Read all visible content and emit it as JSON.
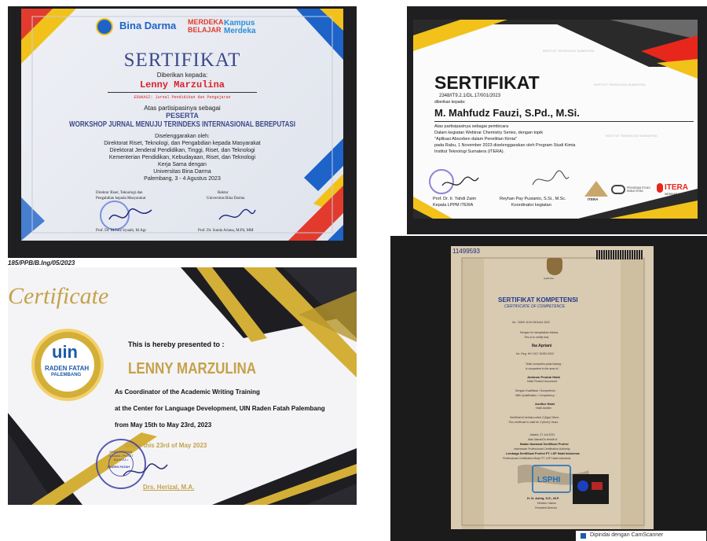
{
  "cert1": {
    "logo_bina": "Bina Darma",
    "logo_merdeka": "MERDEKA BELAJAR",
    "logo_kampus": "Kampus Merdeka",
    "title": "SERTIFIKAT",
    "given_to": "Diberikan kepada:",
    "name": "Lenny Marzulina",
    "edukasi": "EDUKASI: Jurnal Pendidikan dan Pengajaran",
    "atas": "Atas partisipasinya sebagai",
    "role": "PESERTA",
    "event": "WORKSHOP JURNAL MENUJU TERINDEKS INTERNASIONAL BEREPUTASI",
    "organized": "Diselenggarakan oleh:",
    "org1": "Direktorat Riset, Teknologi, dan Pengabdian kepada Masyarakat",
    "org2": "Direktorat Jenderal Pendidikan, Tinggi, Riset, dan Teknologi",
    "org3": "Kementerian Pendidikan, Kebudayaan, Riset, dan Teknologi",
    "coop": "Kerja Sama dengan",
    "univ": "Universitas Bina Darma",
    "place_date": "Palembang, 3 - 4 Agustus 2023",
    "sig_left_title1": "Direktur Riset, Teknologi dan",
    "sig_left_title2": "Pengabdian kepada Masyarakat",
    "sig_left_name": "Prof. Dr. M.Faiz Syuaib, M.Agr",
    "sig_right_title1": "Rektor",
    "sig_right_title2": "Universitas Bina Darma",
    "sig_right_name": "Prof. Dr. Sunda Ariana, M.Pd, MM"
  },
  "cert2": {
    "watermark": "INSTITUT TEKNOLOGI SUMATERA",
    "title": "SERTIFIKAT",
    "number": "2348/IT9.2.1/DL.17/001/2023",
    "given_to": "diberikan kepada:",
    "name": "M. Mahfudz Fauzi, S.Pd., M.Si.",
    "line1": "Atas partisipasinya sebagai pembicara",
    "line2": "Dalam kegiatan Webinar Chemistry Series, dengan topik",
    "line3": "\"Aplikasi Absorben dalam Penelitian Kimia\"",
    "line4": "pada Rabu, 1 November 2023 diselenggarakan oleh Program Studi Kimia",
    "line5": "Institut Teknologi Sumatera (ITERA).",
    "sig_left_name": "Prof. Dr. Ir. Yahdi Zaim",
    "sig_left_role": "Kepala LPPM ITERA",
    "sig_right_name": "Reyhan Pay Pusianto, S.Si., M.Sc.",
    "sig_right_role": "Koordinator kegiatan",
    "logo1": "ITERA",
    "logo2": "PROGRAM STUDI KIMIA ITERA",
    "logo3": "ITERA",
    "logo3_sub": "WEBINAR SERIES"
  },
  "cert3": {
    "ref": "185/PPB/B.Ing/05/2023",
    "title": "Certificate",
    "badge_main": "uin",
    "badge_line1": "RADEN FATAH",
    "badge_line2": "PALEMBANG",
    "presented": "This is hereby presented to :",
    "name": "LENNY MARZULINA",
    "role": "As Coordinator of the Academic Writing Training",
    "place": "at the Center for Language Development, UIN Raden Fatah Palembang",
    "dates": "from May 15th to May 23rd, 2023",
    "given": "Given this 23rd of May 2023",
    "stamp_text": "KEMENTERIAN AGAMA • PUSAT BAHASA •",
    "stamp_center": "RADEN FATAH",
    "signer": "Drs. Herizal, M.A."
  },
  "cert4": {
    "serial": "11499593",
    "garuda": "GARUDA",
    "title": "SERTIFIKAT KOMPETENSI",
    "subtitle": "CERTIFICATE OF COMPETENCE",
    "number": "No. 74909 1100 0901404 2022",
    "declare1": "Dengan ini menyatakan bahwa,",
    "declare2": "This is to certify that,",
    "name": "Ika Apriani",
    "reg": "No. Reg. HH 1917 00150 2022",
    "competent1": "Telah kompeten pada bidang :",
    "competent2": "is competent in the area of :",
    "area1": "Jaminan Produk Halal",
    "area2": "Halal Product Assurance",
    "qual1": "Dengan Kualifikasi / Kompetensi :",
    "qual2": "With Qualification / Competency :",
    "qualification1": "Auditor Halal",
    "qualification2": "Halal Auditor",
    "valid1": "Sertifikat ini berlaku untuk 3 (tiga) Tahun",
    "valid2": "This certificate is valid for 3 (three) Years",
    "place_date": "Jakarta, 27 Juli 2022",
    "onbehalf": "Atas Nama/On behalf of",
    "bnsp1": "Badan Nasional Sertifikasi Profesi",
    "bnsp2": "Indonesian Professional Certification Authority",
    "lsp1": "Lembaga Sertifikasi Profesi PT. LSP Halal Indonesia",
    "lsp2": "Professional Certification Body PT. LSP Halal Indonesia",
    "lsp_logo": "LSPHI",
    "signer": "H. N. Ashiq, S.E., M.P.",
    "signer_role": "Direktur Utama",
    "signer_role2": "President Director",
    "scanner": "Dipindai dengan CamScanner"
  }
}
